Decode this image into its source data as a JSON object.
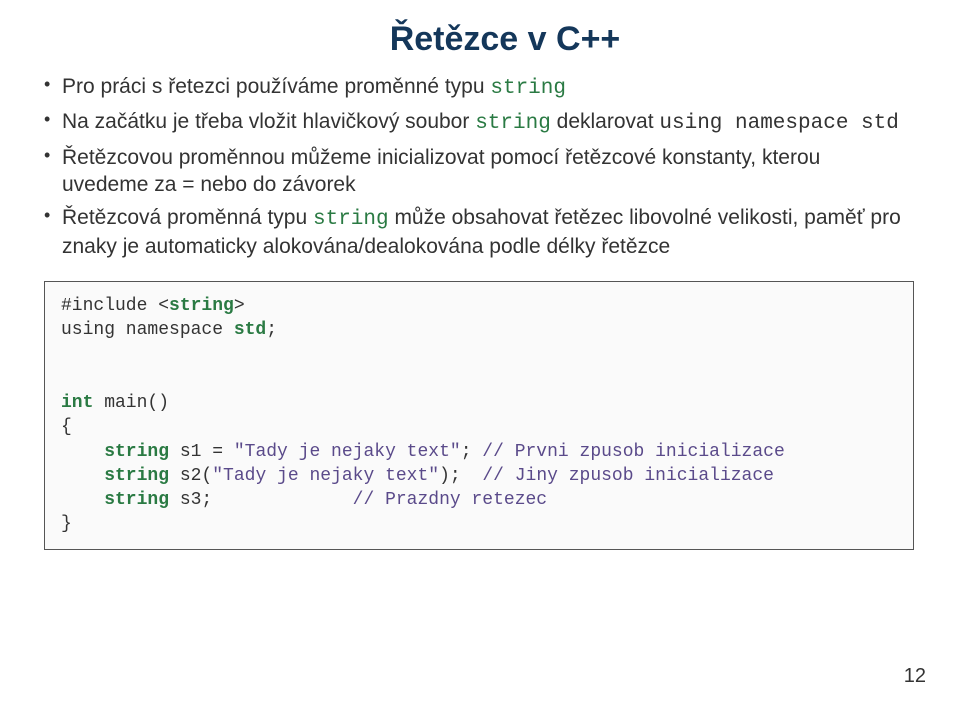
{
  "title": "Řetězce v C++",
  "bullets": {
    "b1": {
      "p1": "Pro práci s řetezci používáme proměnné typu ",
      "c1": "string"
    },
    "b2": {
      "p1": "Na začátku je třeba vložit hlavičkový soubor ",
      "c1": "string",
      "p2": " deklarovat ",
      "c2": "using namespace std"
    },
    "b3": {
      "p1": "Řetězcovou proměnnou můžeme inicializovat pomocí řetězcové konstanty, kterou uvedeme za = nebo do závorek"
    },
    "b4": {
      "p1": "Řetězcová proměnná typu ",
      "c1": "string",
      "p2": " může obsahovat řetězec libovolné velikosti, paměť pro znaky je automaticky alokována/dealokována podle délky řetězce"
    }
  },
  "code": {
    "l1a": "#include <",
    "l1b": "string",
    "l1c": ">",
    "l2a": "using namespace ",
    "l2b": "std",
    "l2c": ";",
    "l4a": "int",
    "l4b": " main()",
    "l5": "{",
    "l6a": "    string",
    "l6b": " s1 = ",
    "l6c": "\"Tady je nejaky text\"",
    "l6d": "; ",
    "l6e": "// Prvni zpusob inicializace",
    "l7a": "    string",
    "l7b": " s2(",
    "l7c": "\"Tady je nejaky text\"",
    "l7d": ");  ",
    "l7e": "// Jiny zpusob inicializace",
    "l8a": "    string",
    "l8b": " s3;             ",
    "l8e": "// Prazdny retezec",
    "l9": "}"
  },
  "page_num": "12"
}
